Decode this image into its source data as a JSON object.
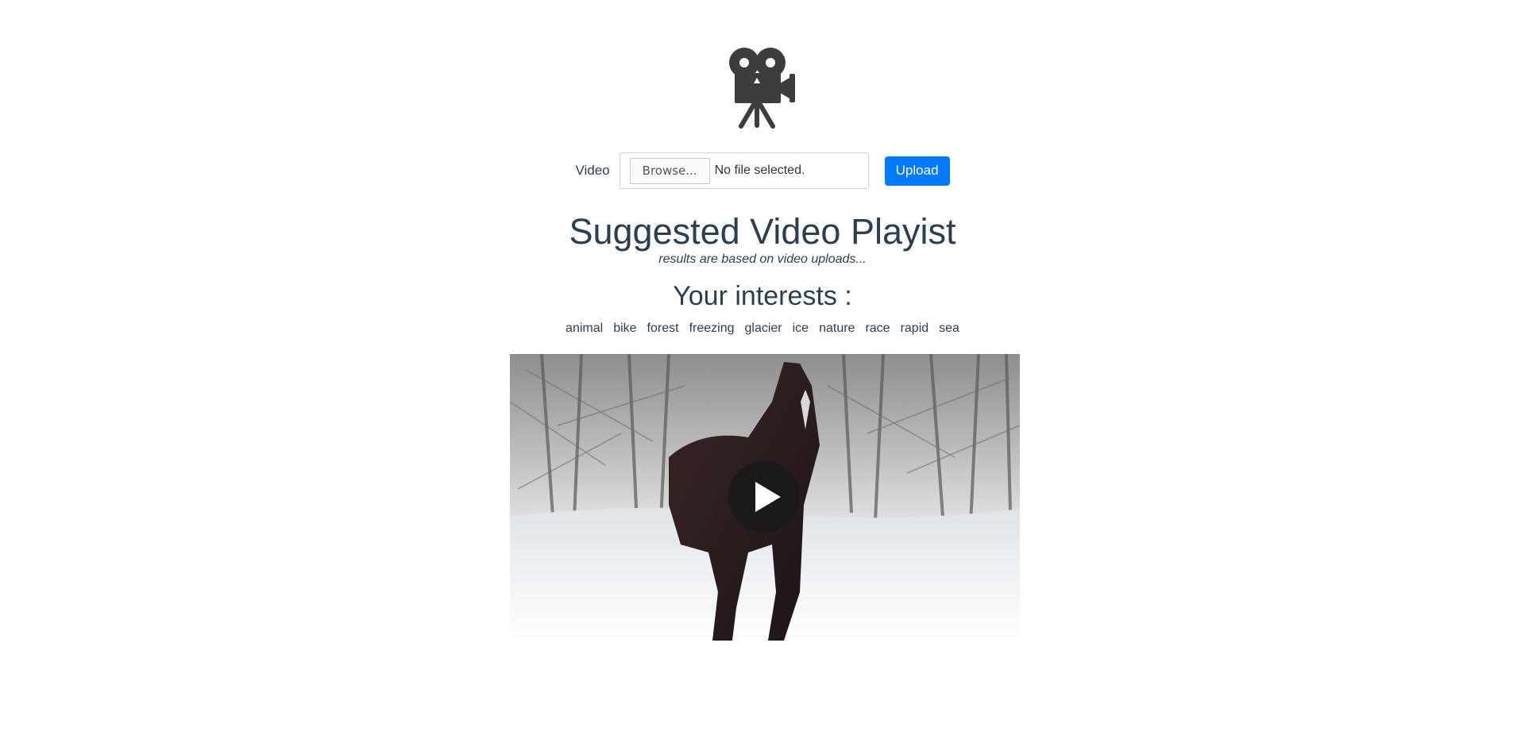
{
  "logo": {
    "icon": "movie-camera-icon"
  },
  "upload": {
    "label": "Video",
    "browse_label": "Browse...",
    "file_status": "No file selected.",
    "upload_button": "Upload"
  },
  "playlist": {
    "title": "Suggested Video Playist",
    "subtitle": "results are based on video uploads...",
    "interests_heading": "Your interests :",
    "tags": [
      "animal",
      "bike",
      "forest",
      "freezing",
      "glacier",
      "ice",
      "nature",
      "race",
      "rapid",
      "sea"
    ]
  },
  "video": {
    "play_icon": "play-icon"
  }
}
